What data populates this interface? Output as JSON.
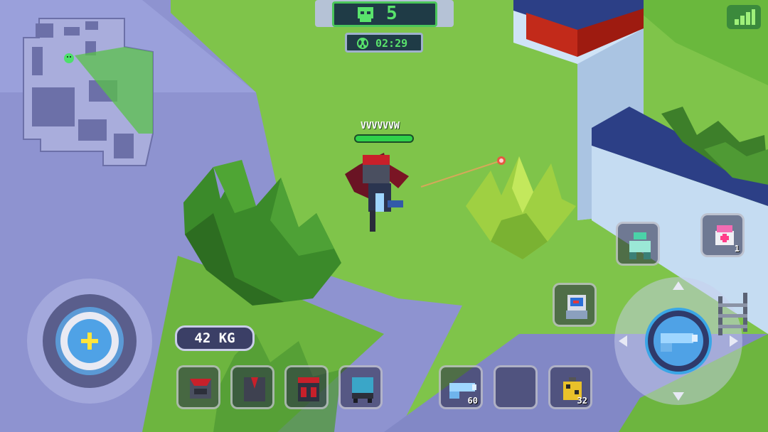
{
  "hud": {
    "kill_count": "5",
    "timer": "02:29",
    "player_name": "VVVVVVW",
    "weight_label": "42 KG"
  },
  "slots": {
    "weapon_primary_ammo": "60",
    "grenade_count": "32",
    "medkit_count": "1"
  },
  "colors": {
    "grass": "#7fc44a",
    "floor": "#8e93d0",
    "hud_green": "#59e36c",
    "hud_panel": "#1f3b46",
    "health": "#2fd24a"
  },
  "icons": {
    "kill": "skull-icon",
    "timer": "radiation-icon",
    "signal": "signal-bars-icon",
    "heal": "plus-icon",
    "aim": "aim-joystick-icon"
  }
}
